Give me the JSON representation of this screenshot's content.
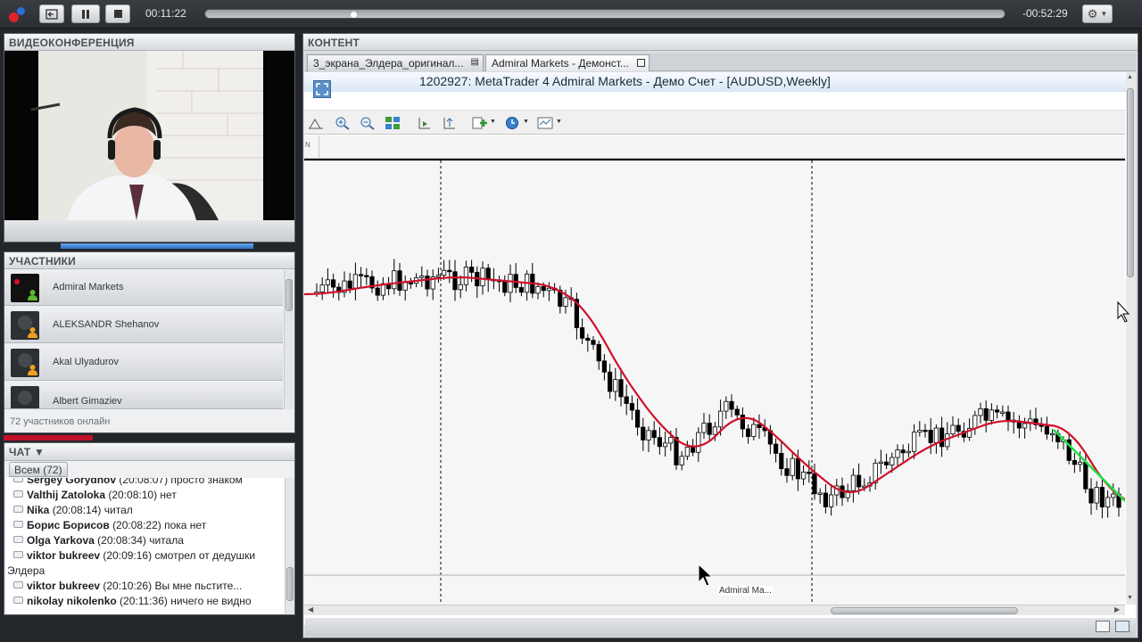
{
  "player": {
    "time_elapsed": "00:11:22",
    "time_remaining": "-00:52:29",
    "progress": 0.183
  },
  "video": {
    "title": "ВИДЕОКОНФЕРЕНЦИЯ"
  },
  "participants": {
    "title": "УЧАСТНИКИ",
    "items": [
      {
        "name": "Admiral Markets"
      },
      {
        "name": "ALEKSANDR Shehanov"
      },
      {
        "name": "Akal Ulyadurov"
      },
      {
        "name": "Albert Gimaziev"
      }
    ],
    "online_count": "72 участников онлайн"
  },
  "chat": {
    "title": "ЧАТ ▼",
    "tab_label": "Всем (72)",
    "messages": [
      {
        "user": "Sergey Gorydnov",
        "time": "(20:08:07)",
        "text": "просто знаком",
        "icon": "message-icon"
      },
      {
        "user": "Valthij Zatoloka",
        "time": "(20:08:10)",
        "text": "нет",
        "icon": "message-icon"
      },
      {
        "user": "Nika",
        "time": " (20:08:14)",
        "text": "читал",
        "icon": "message-icon"
      },
      {
        "user": "Борис Борисов",
        "time": "(20:08:22)",
        "text": "пока нет",
        "icon": "message-icon"
      },
      {
        "user": "Olga Yarkova",
        "time": "(20:08:34)",
        "text": "читала",
        "icon": "message-icon"
      },
      {
        "user": "viktor bukreev",
        "time": "(20:09:16)",
        "text": "смотрел от дедушки",
        "icon": "message-icon"
      },
      {
        "user": "",
        "time": "",
        "text": "Элдера",
        "icon": ""
      },
      {
        "user": "viktor bukreev",
        "time": "(20:10:26)",
        "text": "Вы мне пьстите...",
        "icon": "message-icon"
      },
      {
        "user": "nikolay nikolenko",
        "time": "(20:11:36)",
        "text": "ничего не видно",
        "icon": "message-icon"
      }
    ]
  },
  "content": {
    "title": "КОНТЕНТ",
    "tabs": [
      {
        "label": "3_экрана_Элдера_оригинал..."
      },
      {
        "label": "Admiral Markets - Демонст..."
      }
    ],
    "window_title": "1202927: MetaTrader 4 Admiral Markets - Демо Счет - [AUDUSD,Weekly]",
    "strip_label": "N",
    "cursor_tooltip": "Admiral Ma..."
  },
  "colors": {
    "moving_average": "#d0102a",
    "trend_line": "#22e040",
    "candle": "#000000"
  },
  "chart_data": {
    "type": "candlestick",
    "symbol": "AUDUSD",
    "timeframe": "Weekly",
    "grid": false,
    "series": [
      {
        "name": "",
        "kind": "candles"
      },
      {
        "name": "",
        "kind": "moving-average"
      },
      {
        "name": "",
        "kind": "trend-line"
      }
    ]
  }
}
